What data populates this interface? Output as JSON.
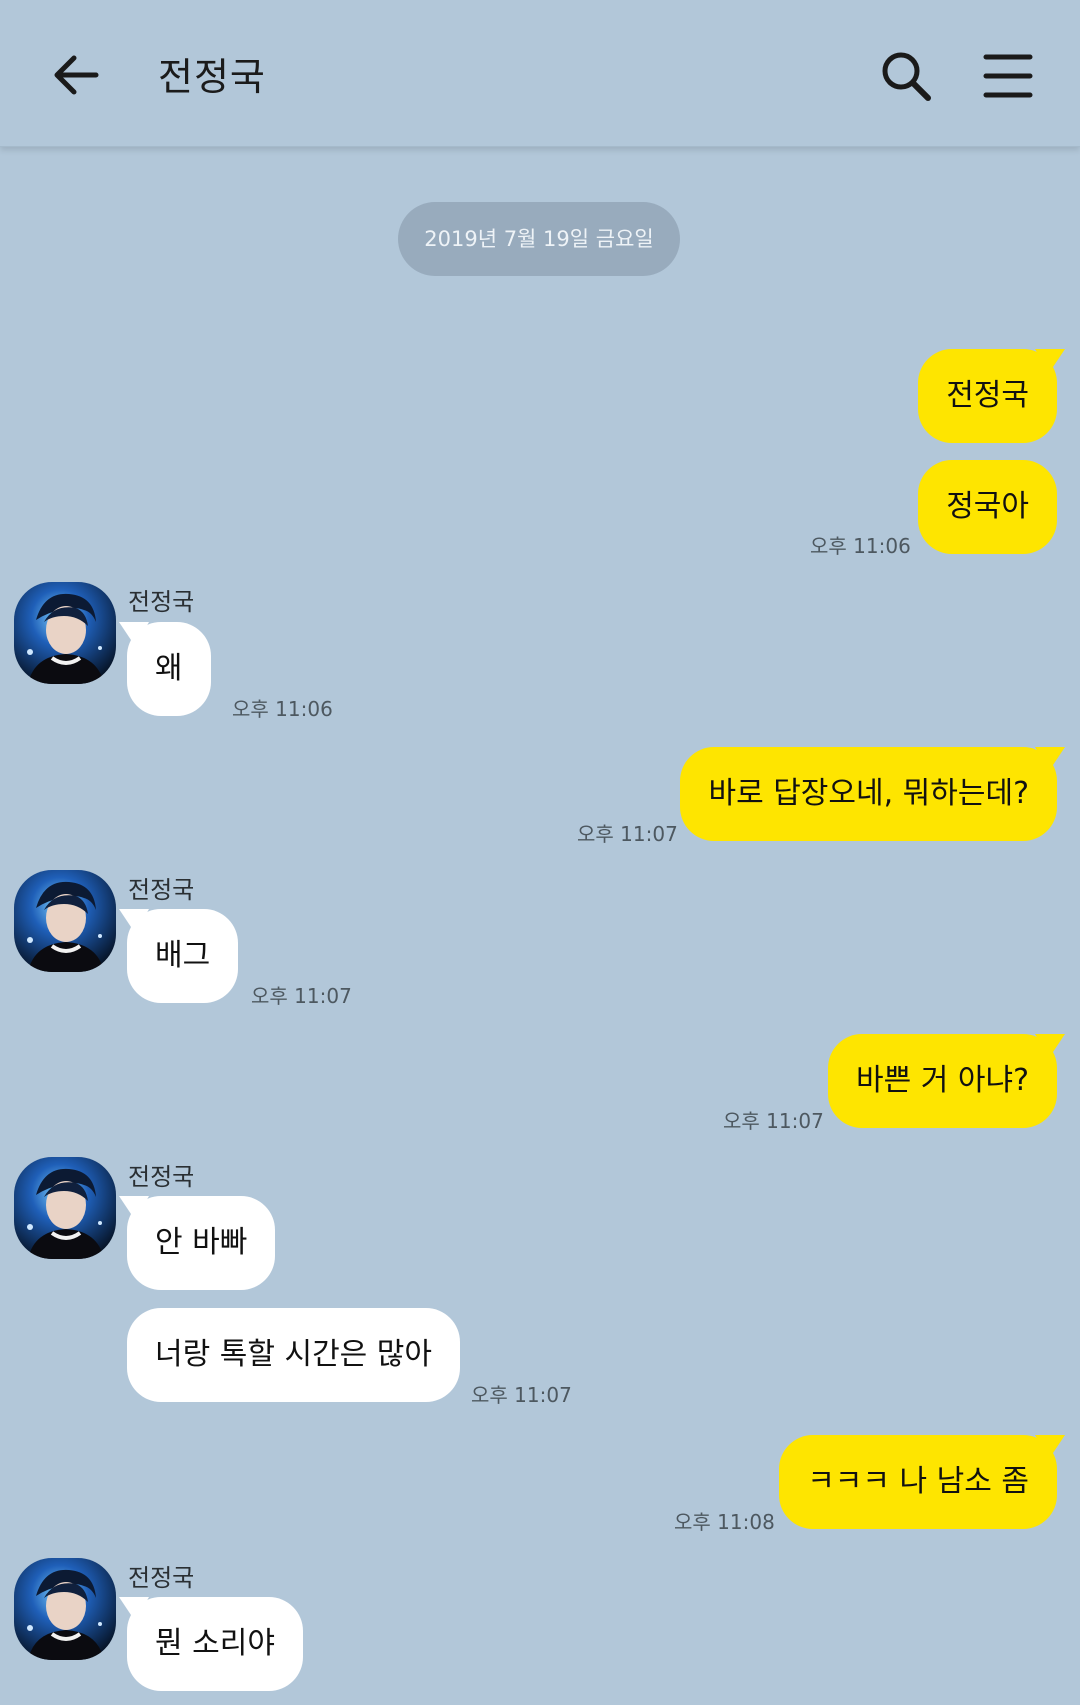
{
  "header": {
    "title": "전정국",
    "back_icon": "arrow-left-icon",
    "search_icon": "search-icon",
    "menu_icon": "menu-icon"
  },
  "date_divider": "2019년 7월 19일 금요일",
  "colors": {
    "background": "#b2c7d9",
    "my_bubble": "#fee500",
    "their_bubble": "#ffffff"
  },
  "messages": [
    {
      "from": "me",
      "text": "전정국"
    },
    {
      "from": "me",
      "text": "정국아",
      "time": "오후 11:06"
    },
    {
      "from": "them",
      "sender": "전정국",
      "text": "왜",
      "time": "오후 11:06"
    },
    {
      "from": "me",
      "text": "바로 답장오네, 뭐하는데?",
      "time": "오후 11:07"
    },
    {
      "from": "them",
      "sender": "전정국",
      "text": "배그",
      "time": "오후 11:07"
    },
    {
      "from": "me",
      "text": "바쁜 거 아냐?",
      "time": "오후 11:07"
    },
    {
      "from": "them",
      "sender": "전정국",
      "text": "안 바빠"
    },
    {
      "from": "them",
      "text": "너랑 톡할 시간은 많아",
      "time": "오후 11:07"
    },
    {
      "from": "me",
      "text": "ㅋㅋㅋ 나 남소 좀",
      "time": "오후 11:08"
    },
    {
      "from": "them",
      "sender": "전정국",
      "text": "뭔 소리야"
    }
  ]
}
